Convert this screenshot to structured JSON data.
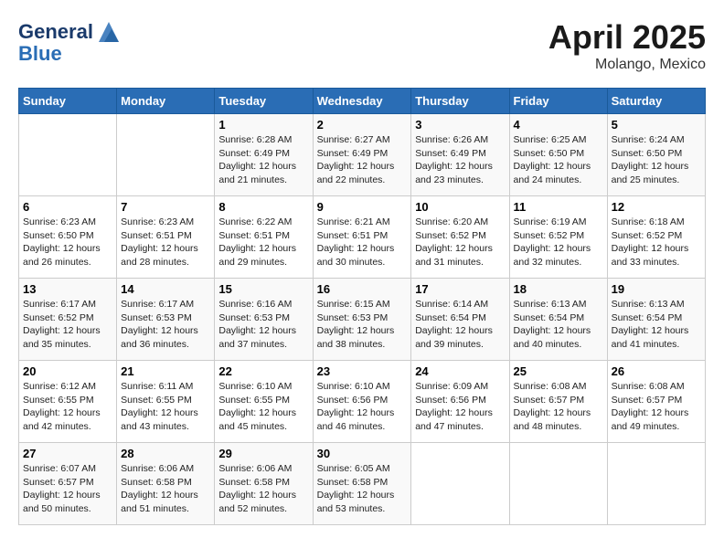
{
  "header": {
    "logo_line1": "General",
    "logo_line2": "Blue",
    "month": "April 2025",
    "location": "Molango, Mexico"
  },
  "weekdays": [
    "Sunday",
    "Monday",
    "Tuesday",
    "Wednesday",
    "Thursday",
    "Friday",
    "Saturday"
  ],
  "weeks": [
    [
      {
        "day": "",
        "sunrise": "",
        "sunset": "",
        "daylight": ""
      },
      {
        "day": "",
        "sunrise": "",
        "sunset": "",
        "daylight": ""
      },
      {
        "day": "1",
        "sunrise": "Sunrise: 6:28 AM",
        "sunset": "Sunset: 6:49 PM",
        "daylight": "Daylight: 12 hours and 21 minutes."
      },
      {
        "day": "2",
        "sunrise": "Sunrise: 6:27 AM",
        "sunset": "Sunset: 6:49 PM",
        "daylight": "Daylight: 12 hours and 22 minutes."
      },
      {
        "day": "3",
        "sunrise": "Sunrise: 6:26 AM",
        "sunset": "Sunset: 6:49 PM",
        "daylight": "Daylight: 12 hours and 23 minutes."
      },
      {
        "day": "4",
        "sunrise": "Sunrise: 6:25 AM",
        "sunset": "Sunset: 6:50 PM",
        "daylight": "Daylight: 12 hours and 24 minutes."
      },
      {
        "day": "5",
        "sunrise": "Sunrise: 6:24 AM",
        "sunset": "Sunset: 6:50 PM",
        "daylight": "Daylight: 12 hours and 25 minutes."
      }
    ],
    [
      {
        "day": "6",
        "sunrise": "Sunrise: 6:23 AM",
        "sunset": "Sunset: 6:50 PM",
        "daylight": "Daylight: 12 hours and 26 minutes."
      },
      {
        "day": "7",
        "sunrise": "Sunrise: 6:23 AM",
        "sunset": "Sunset: 6:51 PM",
        "daylight": "Daylight: 12 hours and 28 minutes."
      },
      {
        "day": "8",
        "sunrise": "Sunrise: 6:22 AM",
        "sunset": "Sunset: 6:51 PM",
        "daylight": "Daylight: 12 hours and 29 minutes."
      },
      {
        "day": "9",
        "sunrise": "Sunrise: 6:21 AM",
        "sunset": "Sunset: 6:51 PM",
        "daylight": "Daylight: 12 hours and 30 minutes."
      },
      {
        "day": "10",
        "sunrise": "Sunrise: 6:20 AM",
        "sunset": "Sunset: 6:52 PM",
        "daylight": "Daylight: 12 hours and 31 minutes."
      },
      {
        "day": "11",
        "sunrise": "Sunrise: 6:19 AM",
        "sunset": "Sunset: 6:52 PM",
        "daylight": "Daylight: 12 hours and 32 minutes."
      },
      {
        "day": "12",
        "sunrise": "Sunrise: 6:18 AM",
        "sunset": "Sunset: 6:52 PM",
        "daylight": "Daylight: 12 hours and 33 minutes."
      }
    ],
    [
      {
        "day": "13",
        "sunrise": "Sunrise: 6:17 AM",
        "sunset": "Sunset: 6:52 PM",
        "daylight": "Daylight: 12 hours and 35 minutes."
      },
      {
        "day": "14",
        "sunrise": "Sunrise: 6:17 AM",
        "sunset": "Sunset: 6:53 PM",
        "daylight": "Daylight: 12 hours and 36 minutes."
      },
      {
        "day": "15",
        "sunrise": "Sunrise: 6:16 AM",
        "sunset": "Sunset: 6:53 PM",
        "daylight": "Daylight: 12 hours and 37 minutes."
      },
      {
        "day": "16",
        "sunrise": "Sunrise: 6:15 AM",
        "sunset": "Sunset: 6:53 PM",
        "daylight": "Daylight: 12 hours and 38 minutes."
      },
      {
        "day": "17",
        "sunrise": "Sunrise: 6:14 AM",
        "sunset": "Sunset: 6:54 PM",
        "daylight": "Daylight: 12 hours and 39 minutes."
      },
      {
        "day": "18",
        "sunrise": "Sunrise: 6:13 AM",
        "sunset": "Sunset: 6:54 PM",
        "daylight": "Daylight: 12 hours and 40 minutes."
      },
      {
        "day": "19",
        "sunrise": "Sunrise: 6:13 AM",
        "sunset": "Sunset: 6:54 PM",
        "daylight": "Daylight: 12 hours and 41 minutes."
      }
    ],
    [
      {
        "day": "20",
        "sunrise": "Sunrise: 6:12 AM",
        "sunset": "Sunset: 6:55 PM",
        "daylight": "Daylight: 12 hours and 42 minutes."
      },
      {
        "day": "21",
        "sunrise": "Sunrise: 6:11 AM",
        "sunset": "Sunset: 6:55 PM",
        "daylight": "Daylight: 12 hours and 43 minutes."
      },
      {
        "day": "22",
        "sunrise": "Sunrise: 6:10 AM",
        "sunset": "Sunset: 6:55 PM",
        "daylight": "Daylight: 12 hours and 45 minutes."
      },
      {
        "day": "23",
        "sunrise": "Sunrise: 6:10 AM",
        "sunset": "Sunset: 6:56 PM",
        "daylight": "Daylight: 12 hours and 46 minutes."
      },
      {
        "day": "24",
        "sunrise": "Sunrise: 6:09 AM",
        "sunset": "Sunset: 6:56 PM",
        "daylight": "Daylight: 12 hours and 47 minutes."
      },
      {
        "day": "25",
        "sunrise": "Sunrise: 6:08 AM",
        "sunset": "Sunset: 6:57 PM",
        "daylight": "Daylight: 12 hours and 48 minutes."
      },
      {
        "day": "26",
        "sunrise": "Sunrise: 6:08 AM",
        "sunset": "Sunset: 6:57 PM",
        "daylight": "Daylight: 12 hours and 49 minutes."
      }
    ],
    [
      {
        "day": "27",
        "sunrise": "Sunrise: 6:07 AM",
        "sunset": "Sunset: 6:57 PM",
        "daylight": "Daylight: 12 hours and 50 minutes."
      },
      {
        "day": "28",
        "sunrise": "Sunrise: 6:06 AM",
        "sunset": "Sunset: 6:58 PM",
        "daylight": "Daylight: 12 hours and 51 minutes."
      },
      {
        "day": "29",
        "sunrise": "Sunrise: 6:06 AM",
        "sunset": "Sunset: 6:58 PM",
        "daylight": "Daylight: 12 hours and 52 minutes."
      },
      {
        "day": "30",
        "sunrise": "Sunrise: 6:05 AM",
        "sunset": "Sunset: 6:58 PM",
        "daylight": "Daylight: 12 hours and 53 minutes."
      },
      {
        "day": "",
        "sunrise": "",
        "sunset": "",
        "daylight": ""
      },
      {
        "day": "",
        "sunrise": "",
        "sunset": "",
        "daylight": ""
      },
      {
        "day": "",
        "sunrise": "",
        "sunset": "",
        "daylight": ""
      }
    ]
  ]
}
